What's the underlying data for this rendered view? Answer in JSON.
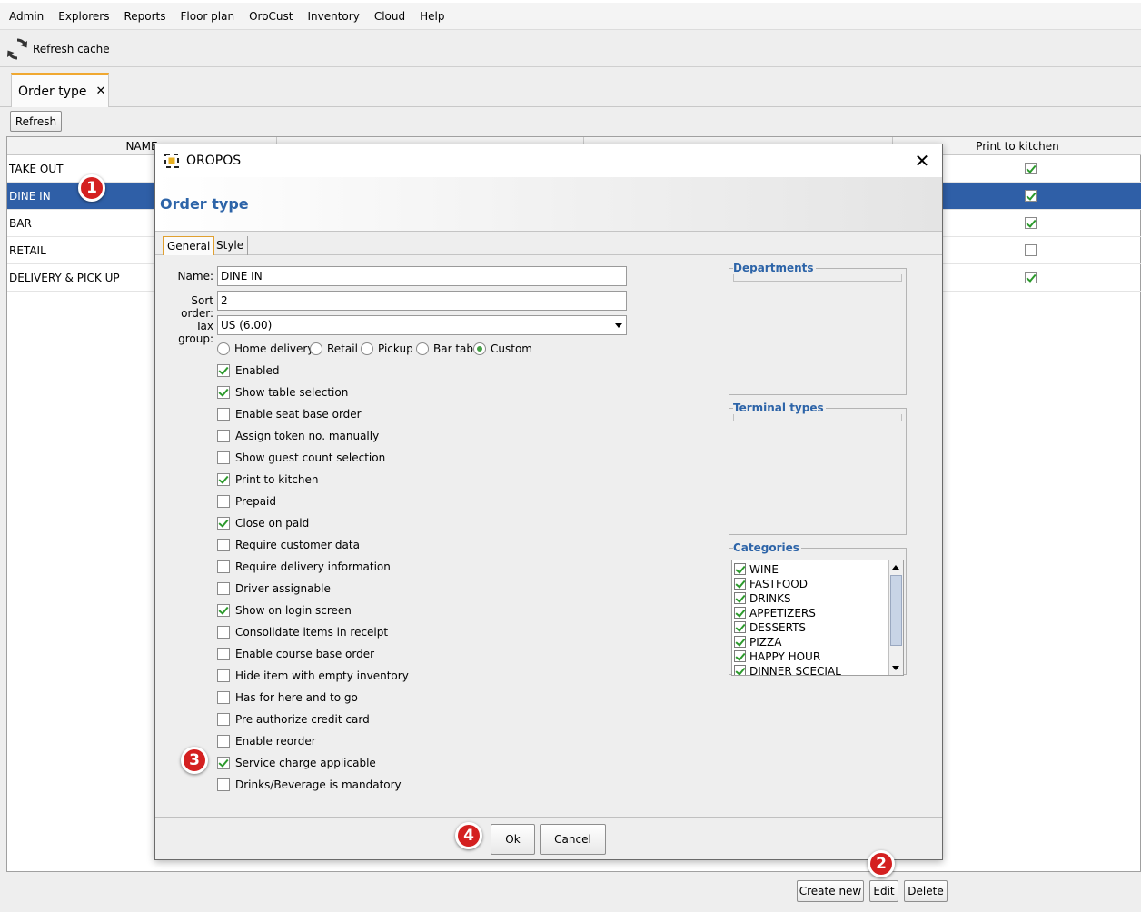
{
  "menu": [
    "Admin",
    "Explorers",
    "Reports",
    "Floor plan",
    "OroCust",
    "Inventory",
    "Cloud",
    "Help"
  ],
  "toolbar": {
    "refresh_cache_label": "Refresh cache",
    "icon": "refresh-icon"
  },
  "tab": {
    "label": "Order type",
    "close": "✕"
  },
  "refresh_button": "Refresh",
  "table": {
    "headers": [
      "NAME",
      "",
      "",
      "Print to kitchen"
    ],
    "rows": [
      {
        "name": "TAKE OUT",
        "print_to_kitchen": true,
        "selected": false
      },
      {
        "name": "DINE IN",
        "print_to_kitchen": true,
        "selected": true
      },
      {
        "name": "BAR",
        "print_to_kitchen": true,
        "selected": false
      },
      {
        "name": "RETAIL",
        "print_to_kitchen": false,
        "selected": false
      },
      {
        "name": "DELIVERY & PICK UP",
        "print_to_kitchen": true,
        "selected": false
      }
    ]
  },
  "bottom_buttons": {
    "create_new": "Create new",
    "edit": "Edit",
    "delete": "Delete"
  },
  "markers": [
    "1",
    "2",
    "3",
    "4"
  ],
  "dialog": {
    "window_title": "OROPOS",
    "close": "✕",
    "header_title": "Order type",
    "tabs": [
      "General",
      "Style"
    ],
    "form": {
      "name_label": "Name:",
      "name_value": "DINE IN",
      "sort_label": "Sort order:",
      "sort_value": "2",
      "tax_label": "Tax group:",
      "tax_value": "US (6.00)"
    },
    "radios": [
      {
        "label": "Home delivery",
        "on": false
      },
      {
        "label": "Retail",
        "on": false
      },
      {
        "label": "Pickup",
        "on": false
      },
      {
        "label": "Bar tab",
        "on": false
      },
      {
        "label": "Custom",
        "on": true
      }
    ],
    "checkboxes": [
      {
        "label": "Enabled",
        "on": true
      },
      {
        "label": "Show table selection",
        "on": true
      },
      {
        "label": "Enable seat base order",
        "on": false
      },
      {
        "label": "Assign token no. manually",
        "on": false
      },
      {
        "label": "Show guest count selection",
        "on": false
      },
      {
        "label": "Print to kitchen",
        "on": true
      },
      {
        "label": "Prepaid",
        "on": false
      },
      {
        "label": "Close on paid",
        "on": true
      },
      {
        "label": "Require customer data",
        "on": false
      },
      {
        "label": "Require delivery information",
        "on": false
      },
      {
        "label": "Driver assignable",
        "on": false
      },
      {
        "label": "Show on login screen",
        "on": true
      },
      {
        "label": "Consolidate items in receipt",
        "on": false
      },
      {
        "label": "Enable course base order",
        "on": false
      },
      {
        "label": "Hide item with empty inventory",
        "on": false
      },
      {
        "label": "Has for here and to go",
        "on": false
      },
      {
        "label": "Pre authorize credit card",
        "on": false
      },
      {
        "label": "Enable reorder",
        "on": false
      },
      {
        "label": "Service charge applicable",
        "on": true
      },
      {
        "label": "Drinks/Beverage is mandatory",
        "on": false
      }
    ],
    "departments_label": "Departments",
    "terminal_types_label": "Terminal types",
    "categories_label": "Categories",
    "categories": [
      "WINE",
      "FASTFOOD",
      "DRINKS",
      "APPETIZERS",
      "DESSERTS",
      "PIZZA",
      "HAPPY HOUR",
      "DINNER SCECIAL"
    ],
    "ok": "Ok",
    "cancel": "Cancel"
  }
}
